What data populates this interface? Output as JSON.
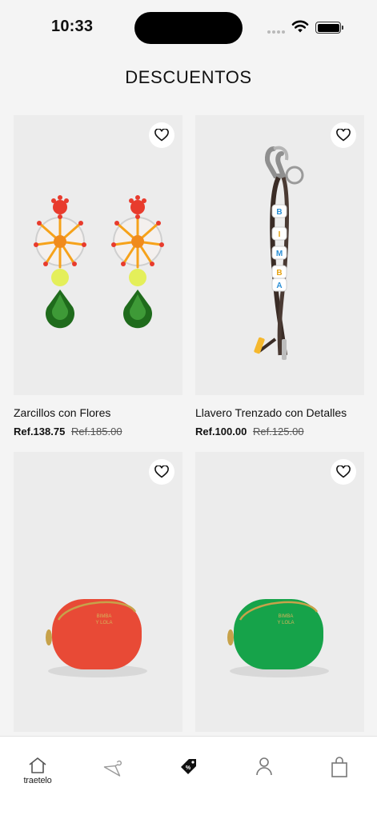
{
  "status": {
    "time": "10:33"
  },
  "header": {
    "title": "DESCUENTOS"
  },
  "products": [
    {
      "name": "Zarcillos con Flores",
      "price": "Ref.138.75",
      "old_price": "Ref.185.00"
    },
    {
      "name": "Llavero Trenzado con Detalles",
      "price": "Ref.100.00",
      "old_price": "Ref.125.00"
    },
    {
      "name": "",
      "price": "",
      "old_price": ""
    },
    {
      "name": "",
      "price": "",
      "old_price": ""
    }
  ],
  "keychain_letters": [
    "B",
    "I",
    "M",
    "B",
    "A"
  ],
  "purse_brand": [
    "BIMBA",
    "Y LOLA"
  ],
  "tabbar": {
    "items": [
      {
        "icon": "home-icon",
        "label": "traetelo"
      },
      {
        "icon": "hanger-icon"
      },
      {
        "icon": "discount-tag-icon"
      },
      {
        "icon": "user-icon"
      },
      {
        "icon": "shopping-bag-icon"
      }
    ]
  },
  "colors": {
    "purse_red": "#e84a36",
    "purse_green": "#16a34a",
    "background": "#f4f4f4"
  }
}
